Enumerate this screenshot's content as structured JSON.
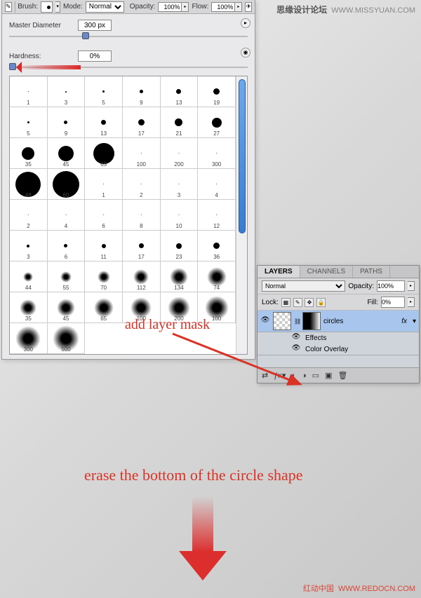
{
  "watermark_top": {
    "zh": "思缘设计论坛",
    "url": "WWW.MISSYUAN.COM"
  },
  "watermark_bottom": {
    "zh": "红动中国",
    "url": "WWW.REDOCN.COM"
  },
  "options_bar": {
    "brush_label": "Brush:",
    "mode_label": "Mode:",
    "mode_value": "Normal",
    "opacity_label": "Opacity:",
    "opacity_value": "100%",
    "flow_label": "Flow:",
    "flow_value": "100%"
  },
  "brush_picker": {
    "master_diameter_label": "Master Diameter",
    "master_diameter_value": "300 px",
    "hardness_label": "Hardness:",
    "hardness_value": "0%",
    "presets_hard": [
      "1",
      "3",
      "5",
      "9",
      "13",
      "19",
      "5",
      "9",
      "13",
      "17",
      "21",
      "27",
      "35",
      "45",
      "65",
      "100",
      "200",
      "300"
    ],
    "presets": [
      {
        "s": 1,
        "lbl": "1"
      },
      {
        "s": 2,
        "lbl": "3"
      },
      {
        "s": 3,
        "lbl": "5"
      },
      {
        "s": 5,
        "lbl": "9"
      },
      {
        "s": 7,
        "lbl": "13"
      },
      {
        "s": 9,
        "lbl": "19"
      },
      {
        "s": 3,
        "lbl": "5"
      },
      {
        "s": 5,
        "lbl": "9"
      },
      {
        "s": 7,
        "lbl": "13"
      },
      {
        "s": 9,
        "lbl": "17"
      },
      {
        "s": 11,
        "lbl": "21"
      },
      {
        "s": 14,
        "lbl": "27"
      },
      {
        "s": 18,
        "lbl": "35"
      },
      {
        "s": 22,
        "lbl": "45"
      },
      {
        "s": 30,
        "lbl": "65"
      },
      {
        "s": 1,
        "lbl": "100",
        "dash": true
      },
      {
        "s": 1,
        "lbl": "200",
        "dash": true
      },
      {
        "s": 1,
        "lbl": "300",
        "dash": true
      },
      {
        "s": 36,
        "lbl": "48"
      },
      {
        "s": 38,
        "lbl": "60"
      },
      {
        "s": 1,
        "lbl": "1",
        "dash": true
      },
      {
        "s": 1,
        "lbl": "2",
        "dash": true
      },
      {
        "s": 1,
        "lbl": "3",
        "dash": true
      },
      {
        "s": 1,
        "lbl": "4",
        "dash": true
      },
      {
        "s": 1,
        "lbl": "2",
        "dash": true
      },
      {
        "s": 1,
        "lbl": "4",
        "dash": true
      },
      {
        "s": 1,
        "lbl": "6",
        "dash": true
      },
      {
        "s": 1,
        "lbl": "8",
        "dash": true
      },
      {
        "s": 1,
        "lbl": "10",
        "dash": true
      },
      {
        "s": 1,
        "lbl": "12",
        "dash": true
      },
      {
        "s": 4,
        "lbl": "3"
      },
      {
        "s": 5,
        "lbl": "6"
      },
      {
        "s": 6,
        "lbl": "11"
      },
      {
        "s": 7,
        "lbl": "17"
      },
      {
        "s": 8,
        "lbl": "23"
      },
      {
        "s": 9,
        "lbl": "36"
      },
      {
        "soft": true,
        "s": 14,
        "lbl": "44"
      },
      {
        "soft": true,
        "s": 16,
        "lbl": "55"
      },
      {
        "soft": true,
        "s": 18,
        "lbl": "70"
      },
      {
        "soft": true,
        "s": 22,
        "lbl": "112"
      },
      {
        "soft": true,
        "s": 26,
        "lbl": "134"
      },
      {
        "soft": true,
        "s": 28,
        "lbl": "74"
      },
      {
        "soft": true,
        "s": 24,
        "lbl": "35"
      },
      {
        "soft": true,
        "s": 26,
        "lbl": "45"
      },
      {
        "soft": true,
        "s": 28,
        "lbl": "65"
      },
      {
        "soft": true,
        "s": 30,
        "lbl": "100"
      },
      {
        "soft": true,
        "s": 32,
        "lbl": "200"
      },
      {
        "soft": true,
        "s": 34,
        "lbl": "100"
      },
      {
        "soft": true,
        "s": 36,
        "lbl": "300"
      },
      {
        "soft": true,
        "s": 38,
        "lbl": "500"
      }
    ]
  },
  "layers_panel": {
    "tabs": [
      "LAYERS",
      "CHANNELS",
      "PATHS"
    ],
    "blend_mode": "Normal",
    "opacity_label": "Opacity:",
    "opacity_value": "100%",
    "lock_label": "Lock:",
    "fill_label": "Fill:",
    "fill_value": "0%",
    "layer_name": "circles",
    "fx_label": "fx",
    "effects_label": "Effects",
    "color_overlay_label": "Color Overlay"
  },
  "annotations": {
    "add_layer_mask": "add layer mask",
    "erase_bottom": "erase the bottom of the circle shape"
  }
}
